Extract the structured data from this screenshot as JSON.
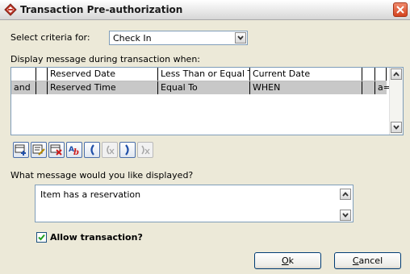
{
  "window": {
    "title": "Transaction Pre-authorization"
  },
  "criteria": {
    "label": "Select criteria for:",
    "value": "Check In"
  },
  "display_label": "Display message during transaction when:",
  "table": {
    "rows": [
      {
        "conj": "",
        "field": "Reserved Date",
        "op": "Less Than or Equal To",
        "value": "Current Date",
        "extra": "",
        "tag": ""
      },
      {
        "conj": "and",
        "field": "Reserved Time",
        "op": "Equal To",
        "value": "WHEN",
        "extra": "",
        "tag": "a=A"
      }
    ]
  },
  "toolbar": {
    "buttons": [
      "add-row-icon",
      "edit-row-icon",
      "delete-row-icon",
      "spell-check-icon",
      "open-paren-icon",
      "remove-open-paren-icon",
      "close-paren-icon",
      "remove-close-paren-icon"
    ]
  },
  "message": {
    "question": "What message would you like displayed?",
    "text": "Item has a reservation"
  },
  "allow": {
    "label": "Allow transaction?",
    "checked": true
  },
  "buttons": {
    "ok": {
      "mnemonic": "O",
      "rest": "k"
    },
    "cancel": {
      "mnemonic": "C",
      "rest": "ancel"
    }
  },
  "colors": {
    "accent": "#1c5180",
    "selection": "#c8c8c8",
    "close": "#d4431f"
  }
}
